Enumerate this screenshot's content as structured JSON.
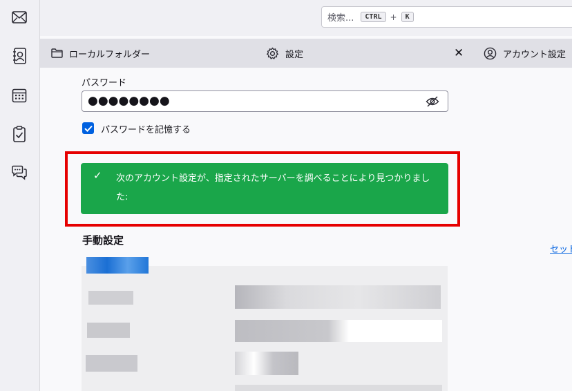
{
  "search": {
    "placeholder": "検索...",
    "key1": "CTRL",
    "plus": "+",
    "key2": "K"
  },
  "tabs": {
    "folder": "ローカルフォルダー",
    "settings": "設定",
    "account_settings": "アカウント設定",
    "close_symbol": "✕"
  },
  "form": {
    "password_label": "パスワード",
    "password_value": "●●●●●●●●",
    "remember_label": "パスワードを記憶する"
  },
  "notice": {
    "check": "✓",
    "message": "次のアカウント設定が、指定されたサーバーを調べることにより見つかりました:"
  },
  "manual": {
    "title": "手動設定",
    "link_partial": "セット"
  },
  "colors": {
    "accent": "#0061e0",
    "success": "#1aa64a",
    "highlight": "#e60000"
  }
}
